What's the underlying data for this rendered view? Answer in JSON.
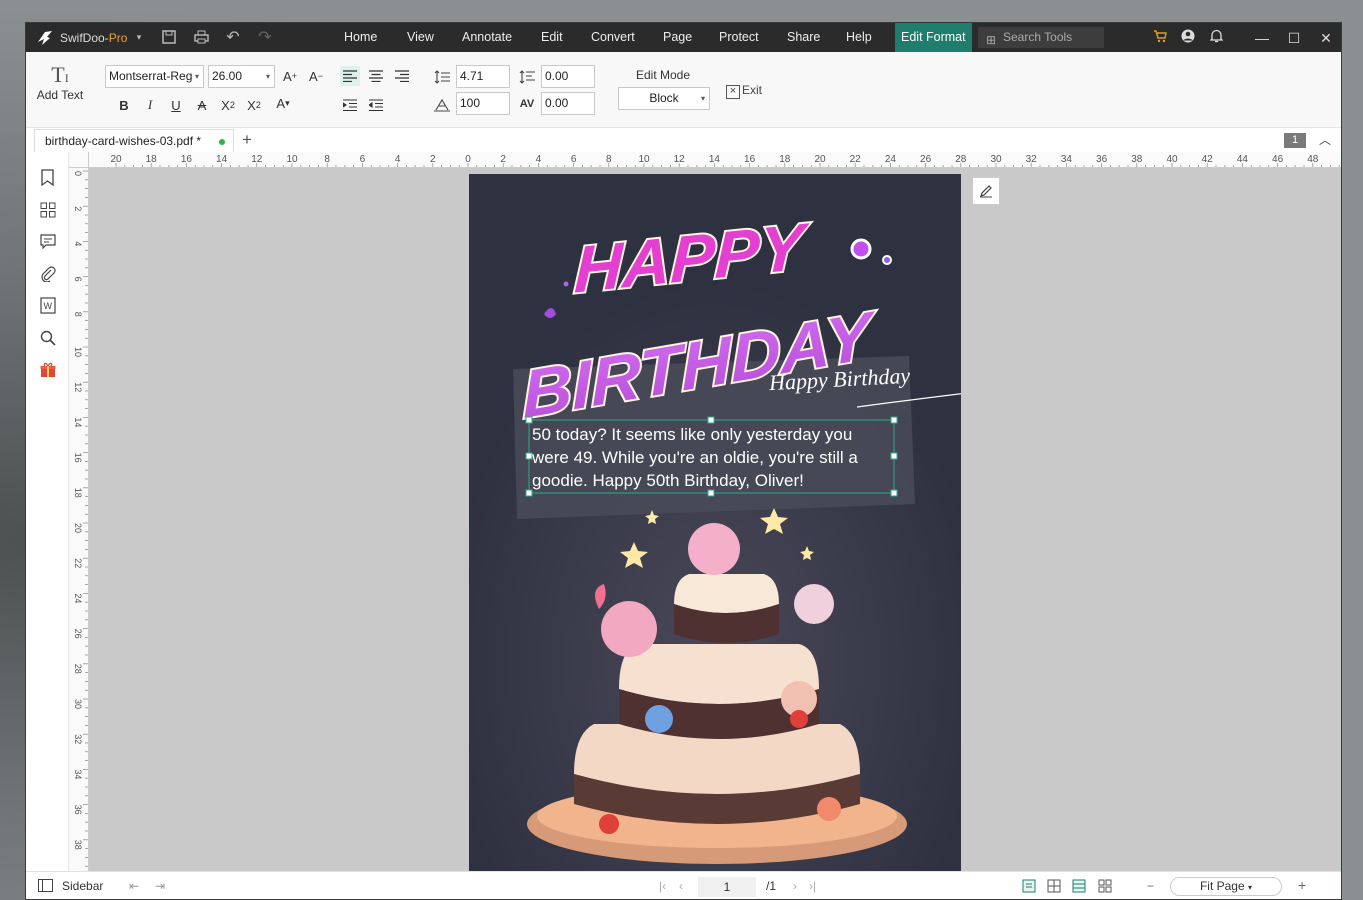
{
  "app": {
    "brand": "SwifDoo-",
    "brand_suffix": "Pro"
  },
  "menu": [
    "Home",
    "View",
    "Annotate",
    "Edit",
    "Convert",
    "Page",
    "Protect",
    "Share",
    "Help"
  ],
  "active_menu": "Edit Format",
  "search": {
    "placeholder": "Search Tools"
  },
  "ribbon": {
    "add_text": "Add Text",
    "font_family": "Montserrat-Reg",
    "font_size": "26.00",
    "line_spacing": "4.71",
    "para_spacing": "0.00",
    "scale": "100",
    "char_spacing": "0.00",
    "edit_mode_label": "Edit Mode",
    "edit_mode_value": "Block",
    "exit_label": "Exit"
  },
  "tab": {
    "filename": "birthday-card-wishes-03.pdf *",
    "page_badge": "1"
  },
  "ruler": {
    "h_labels": [
      "20",
      "18",
      "16",
      "14",
      "12",
      "10",
      "8",
      "6",
      "4",
      "2",
      "0",
      "2",
      "4",
      "6",
      "8",
      "10",
      "12",
      "14",
      "16",
      "18",
      "20",
      "22",
      "24",
      "26",
      "28",
      "30",
      "32",
      "34",
      "36",
      "38",
      "40",
      "42",
      "44",
      "46",
      "48"
    ],
    "v_labels": [
      "0",
      "2",
      "4",
      "6",
      "8",
      "10",
      "12",
      "14",
      "16",
      "18",
      "20",
      "22",
      "24",
      "26",
      "28",
      "30",
      "32",
      "34",
      "36",
      "38"
    ]
  },
  "card": {
    "happy": "HAPPY",
    "birthday": "BIRTHDAY",
    "script": "Happy Birthday",
    "message_lines": [
      "50 today? It seems like only yesterday you",
      "were 49. While you're an oldie, you're still a",
      "goodie. Happy 50th Birthday, Oliver!"
    ]
  },
  "status": {
    "sidebar": "Sidebar",
    "page_current": "1",
    "page_total": "/1",
    "zoom": "Fit Page"
  },
  "colors": {
    "accent": "#1f7d6e",
    "titlebar": "#2b2b2b",
    "card_bg": "#2e3140",
    "title_pink": "#e33fd0"
  }
}
